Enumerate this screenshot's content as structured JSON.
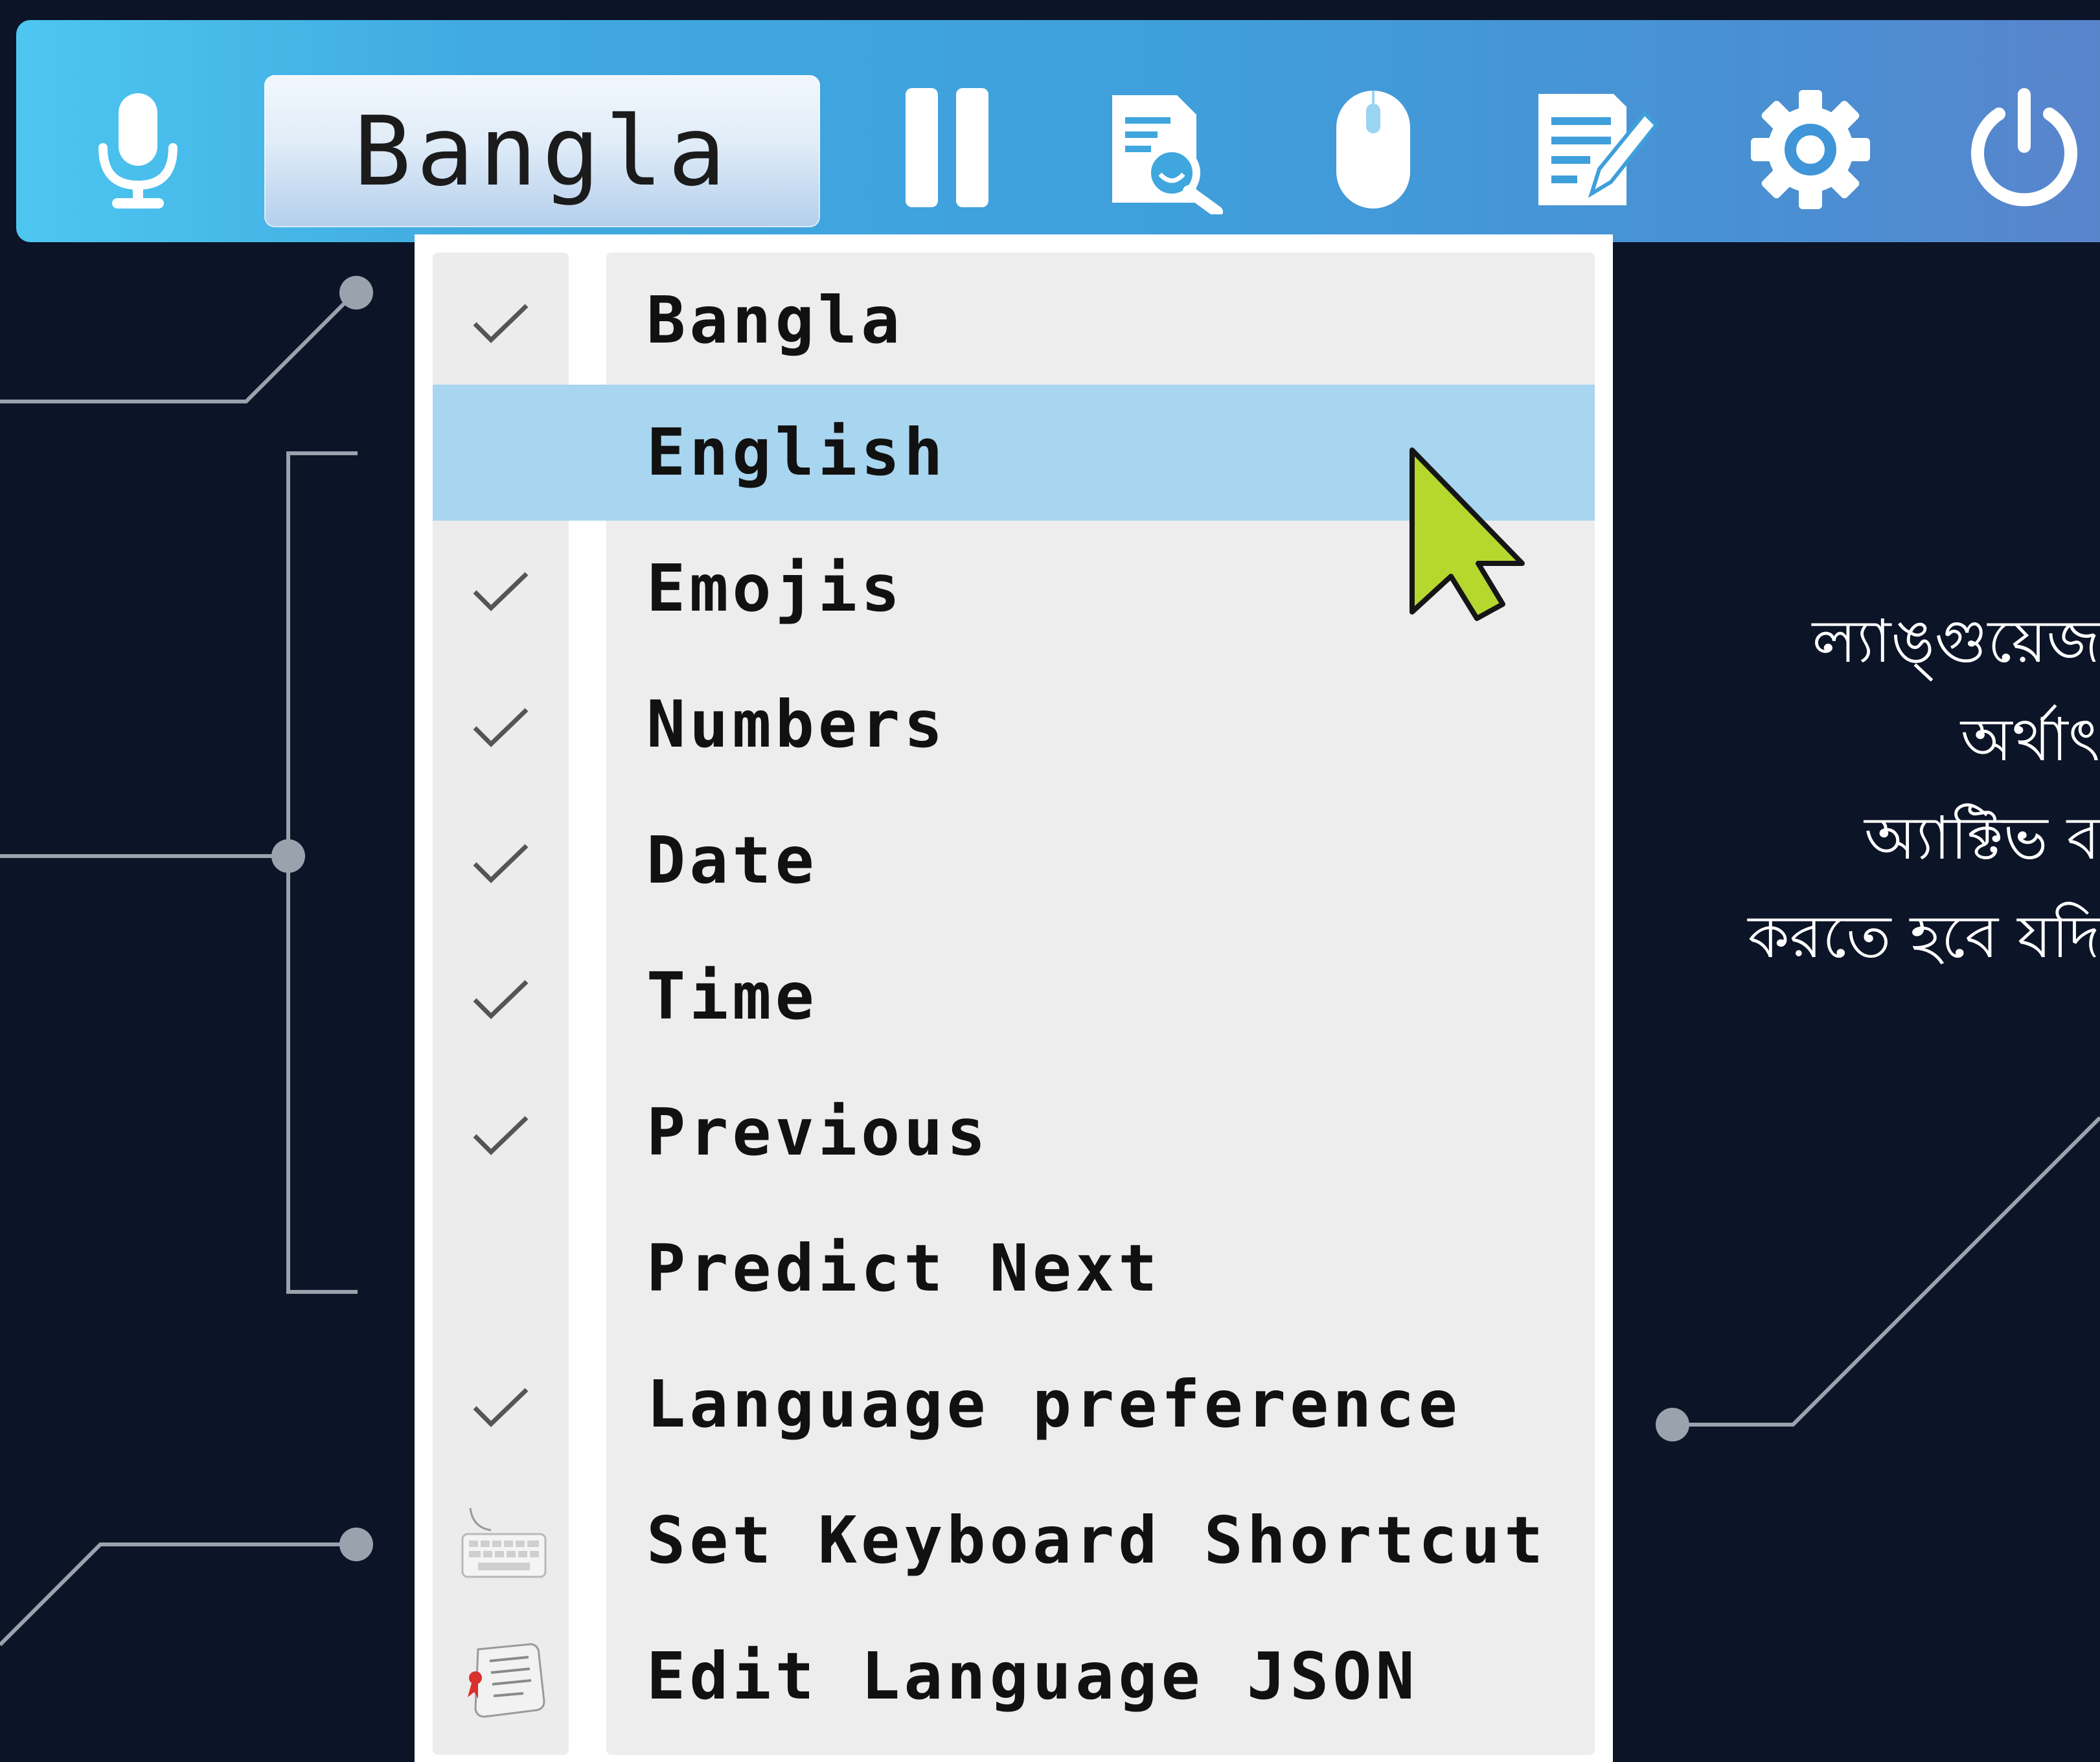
{
  "toolbar": {
    "language_button_label": "Bangla",
    "icons": [
      "microphone-icon",
      "pause-icon",
      "document-search-icon",
      "mouse-icon",
      "edit-document-icon",
      "gear-icon",
      "power-icon"
    ]
  },
  "menu": {
    "items": [
      {
        "label": "Bangla",
        "checked": true
      },
      {
        "label": "English",
        "checked": false,
        "highlighted": true
      },
      {
        "label": "Emojis",
        "checked": true
      },
      {
        "label": "Numbers",
        "checked": true
      },
      {
        "label": "Date",
        "checked": true
      },
      {
        "label": "Time",
        "checked": true
      },
      {
        "label": "Previous",
        "checked": true
      },
      {
        "label": "Predict Next",
        "checked": false
      },
      {
        "label": "Language preference",
        "checked": true
      },
      {
        "label": "Set Keyboard Shortcut",
        "icon": "keyboard-icon"
      },
      {
        "label": "Edit Language JSON",
        "icon": "scroll-icon"
      }
    ]
  },
  "side_text": {
    "lines": [
      "ল্যাঙ্গুয়েজ",
      "অর্থাৎ",
      "অ্যাক্টিভ ব",
      "করতে হবে যদি"
    ]
  },
  "colors": {
    "background": "#0c1427",
    "toolbar_start": "#4dc6f0",
    "toolbar_end": "#5a84cc",
    "menu_highlight": "#a8d5ef",
    "cursor_fill": "#b5d72e"
  }
}
